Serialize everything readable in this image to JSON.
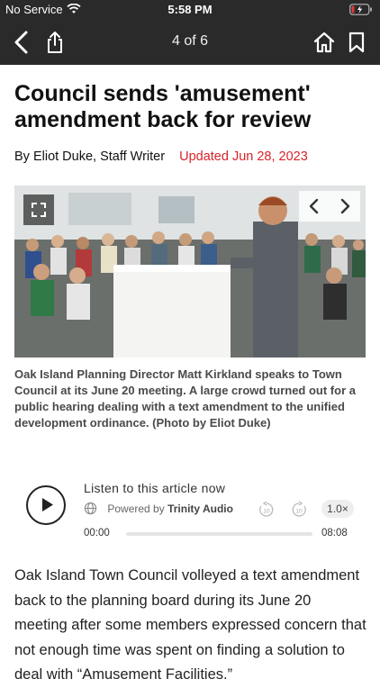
{
  "status_bar": {
    "carrier": "No Service",
    "time": "5:58 PM"
  },
  "nav": {
    "page_indicator": "4 of 6",
    "icons": [
      "back-chevron-icon",
      "share-icon",
      "home-icon",
      "bookmark-icon"
    ]
  },
  "article": {
    "headline": "Council sends 'amusement' amendment back for review",
    "byline": "By Eliot Duke, Staff Writer",
    "updated": "Updated Jun 28, 2023",
    "caption": "Oak Island Planning Director Matt Kirkland speaks to Town Council at its June 20 meeting. A large crowd turned out for a public hearing dealing with a text amendment to the unified development ordinance. (Photo by Eliot Duke)",
    "body": "Oak Island Town Council volleyed a text amendment back to the planning board during its June 20 meeting after some members expressed concern that not enough time was spent on finding a solution to deal with “Amusement Facilities.”"
  },
  "audio": {
    "listen_label": "Listen to this article now",
    "powered_by": "Powered by",
    "brand": "Trinity Audio",
    "speed": "1.0×",
    "time_now": "00:00",
    "time_total": "08:08",
    "progress": 0,
    "skip_back_label": "10",
    "skip_forward_label": "10"
  },
  "colors": {
    "header_bg": "#2a2a2a",
    "updated_red": "#d8232a",
    "caption_gray": "#4a4a4a"
  }
}
